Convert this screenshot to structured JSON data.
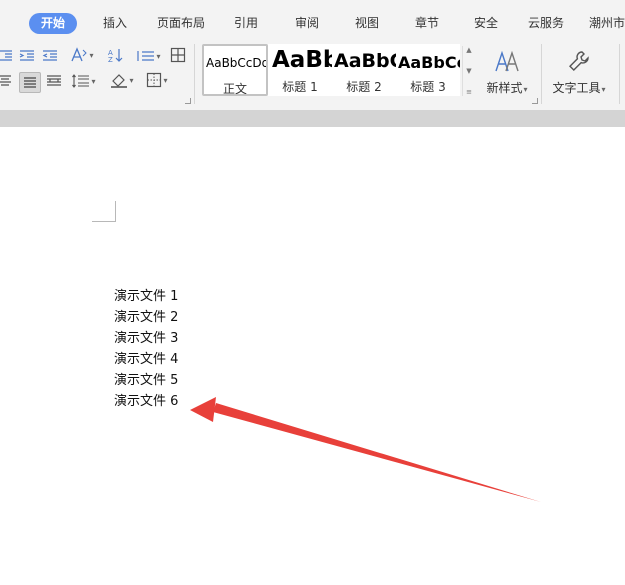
{
  "tabs": [
    {
      "label": "开始",
      "active": true
    },
    {
      "label": "插入"
    },
    {
      "label": "页面布局"
    },
    {
      "label": "引用"
    },
    {
      "label": "审阅"
    },
    {
      "label": "视图"
    },
    {
      "label": "章节"
    },
    {
      "label": "安全"
    },
    {
      "label": "云服务"
    },
    {
      "label": "潮州市"
    }
  ],
  "styles": [
    {
      "preview": "AaBbCcDd",
      "name": "正文"
    },
    {
      "preview": "AaBb",
      "name": "标题 1"
    },
    {
      "preview": "AaBbC",
      "name": "标题 2"
    },
    {
      "preview": "AaBbCc",
      "name": "标题 3"
    }
  ],
  "buttons": {
    "new_style": "新样式",
    "text_tools": "文字工具"
  },
  "icons": {
    "decrease_indent": "decrease-indent-icon",
    "increase_indent": "increase-indent-icon",
    "text_direction": "text-direction-icon",
    "sort": "sort-icon",
    "line_spacing": "line-spacing-icon",
    "table": "table-icon",
    "align_center": "align-center-icon",
    "align_justify": "align-justify-icon",
    "distributed": "distributed-align-icon",
    "paragraph_spacing": "paragraph-spacing-icon",
    "shading": "shading-icon",
    "borders": "borders-icon",
    "new_style": "new-style-icon",
    "text_tools": "wrench-icon"
  },
  "document": {
    "lines": [
      "演示文件 1",
      "演示文件 2",
      "演示文件 3",
      "演示文件 4",
      "演示文件 5",
      "演示文件 6"
    ]
  },
  "colors": {
    "active_tab": "#5b8ff0",
    "arrow": "#e8403a"
  }
}
